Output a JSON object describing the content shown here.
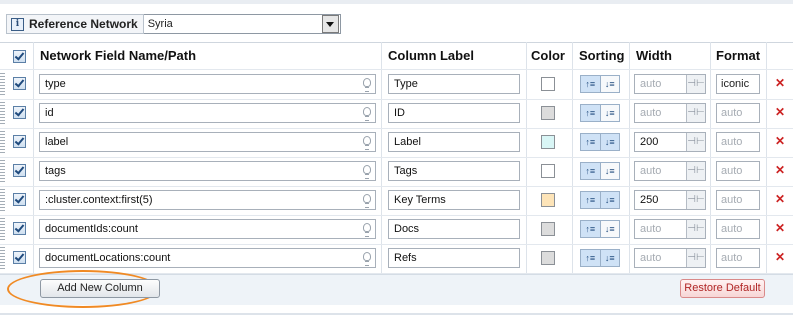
{
  "reference": {
    "label": "Reference Network",
    "value": "Syria"
  },
  "columns_header": {
    "path": "Network Field Name/Path",
    "label": "Column Label",
    "color": "Color",
    "sorting": "Sorting",
    "width": "Width",
    "format": "Format"
  },
  "rows": [
    {
      "path": "type",
      "label": "Type",
      "color": "#ffffff",
      "width": "auto",
      "width_set": false,
      "format": "iconic",
      "format_set": true,
      "sort": "asc"
    },
    {
      "path": "id",
      "label": "ID",
      "color": "#dcdcdc",
      "width": "auto",
      "width_set": false,
      "format": "auto",
      "format_set": false,
      "sort": "asc"
    },
    {
      "path": "label",
      "label": "Label",
      "color": "#d9f6f6",
      "width": "200",
      "width_set": true,
      "format": "auto",
      "format_set": false,
      "sort": "both"
    },
    {
      "path": "tags",
      "label": "Tags",
      "color": "#ffffff",
      "width": "auto",
      "width_set": false,
      "format": "auto",
      "format_set": false,
      "sort": "asc"
    },
    {
      "path": ":cluster.context:first(5)",
      "label": "Key Terms",
      "color": "#fde4b8",
      "width": "250",
      "width_set": true,
      "format": "auto",
      "format_set": false,
      "sort": "both"
    },
    {
      "path": "documentIds:count",
      "label": "Docs",
      "color": "#dcdcdc",
      "width": "auto",
      "width_set": false,
      "format": "auto",
      "format_set": false,
      "sort": "asc"
    },
    {
      "path": "documentLocations:count",
      "label": "Refs",
      "color": "#dcdcdc",
      "width": "auto",
      "width_set": false,
      "format": "auto",
      "format_set": false,
      "sort": "both"
    }
  ],
  "buttons": {
    "add": "Add New Column",
    "restore": "Restore Default"
  },
  "icons": {
    "info": "info-icon",
    "dropdown": "chevron-down-icon",
    "checkbox": "checkbox-icon",
    "hint": "lightbulb-icon",
    "sort_asc": "sort-ascending-icon",
    "sort_desc": "sort-descending-icon",
    "stepper": "width-stepper-icon",
    "delete": "close-icon"
  },
  "colors": {
    "highlight_ring": "#f08a24",
    "delete": "#cc2222",
    "footer_bg": "#eef3f8"
  }
}
